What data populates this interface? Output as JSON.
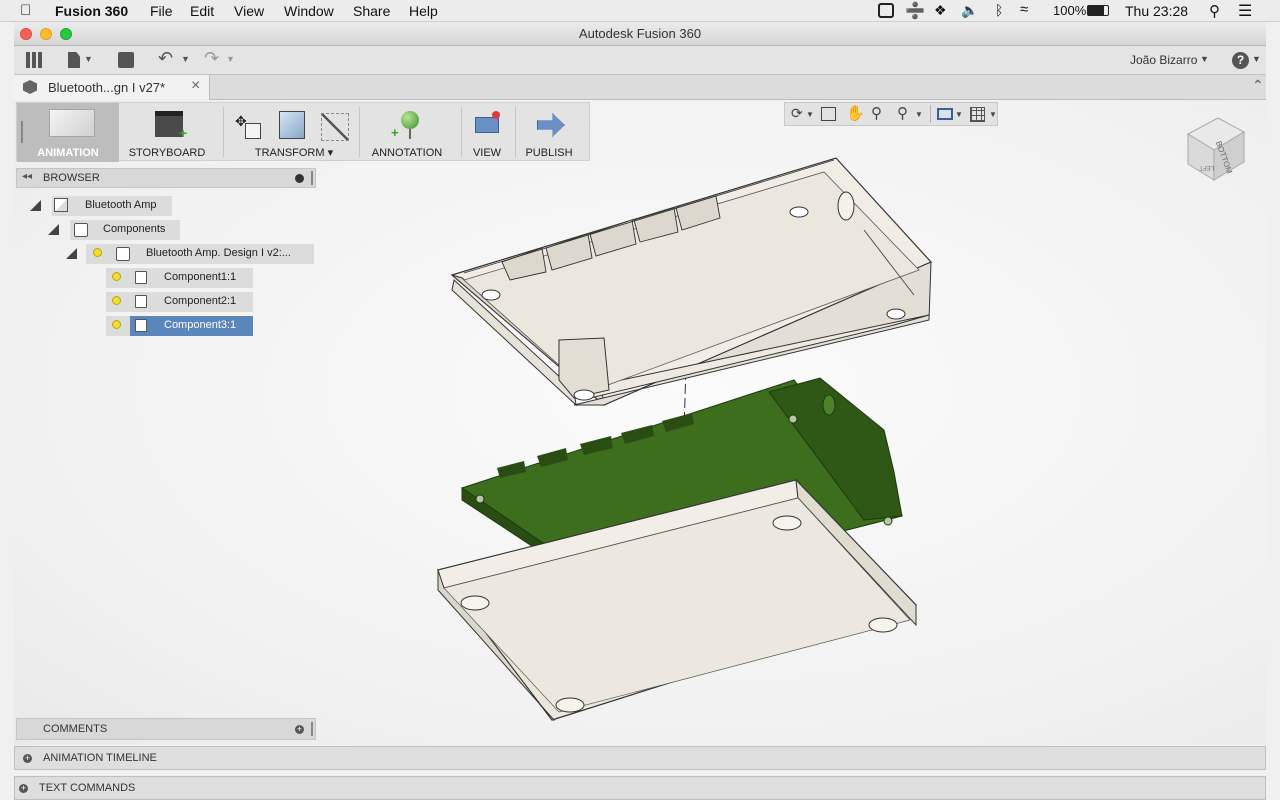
{
  "menubar": {
    "app_name": "Fusion 360",
    "items": [
      "File",
      "Edit",
      "View",
      "Window",
      "Share",
      "Help"
    ],
    "battery": "100%",
    "clock": "Thu 23:28"
  },
  "window": {
    "title": "Autodesk Fusion 360"
  },
  "app_toolbar": {
    "user": "João Bizarro"
  },
  "document_tab": {
    "label": "Bluetooth...gn I v27*"
  },
  "ribbon": {
    "workspace": "ANIMATION",
    "storyboard": "STORYBOARD",
    "transform": "TRANSFORM",
    "annotation": "ANNOTATION",
    "view": "VIEW",
    "publish": "PUBLISH"
  },
  "browser": {
    "title": "BROWSER",
    "root": "Bluetooth Amp",
    "components_folder": "Components",
    "design": "Bluetooth Amp. Design I v2:...",
    "components": [
      "Component1:1",
      "Component2:1",
      "Component3:1"
    ],
    "selected_index": 2
  },
  "viewcube": {
    "top_label": "BOTTOM",
    "side_label": "LEFT"
  },
  "panels": {
    "comments": "COMMENTS",
    "animation_timeline": "ANIMATION TIMELINE",
    "text_commands": "TEXT COMMANDS"
  },
  "colors": {
    "selection": "#5b86bb",
    "pcb_green": "#3d6e1e",
    "case_beige": "#ebe7de"
  }
}
